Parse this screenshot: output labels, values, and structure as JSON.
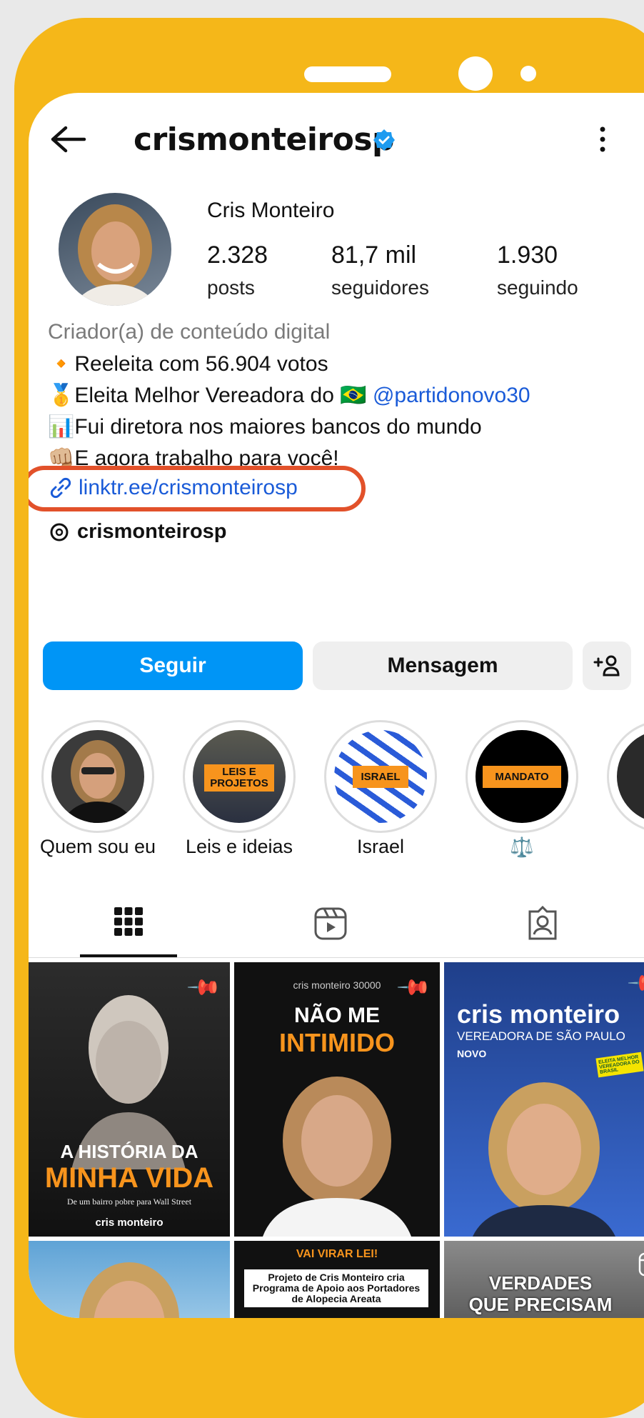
{
  "header": {
    "username": "crismonteirosp"
  },
  "profile": {
    "name": "Cris Monteiro",
    "stats": [
      {
        "value": "2.328",
        "label": "posts"
      },
      {
        "value": "81,7 mil",
        "label": "seguidores"
      },
      {
        "value": "1.930",
        "label": "seguindo"
      }
    ],
    "category": "Criador(a) de conteúdo digital",
    "bio_lines": [
      {
        "emoji": "🔸",
        "text": "Reeleita com 56.904 votos"
      },
      {
        "emoji": "🥇",
        "text": "Eleita Melhor Vereadora do ",
        "flag": "🇧🇷",
        "mention": "@partidonovo30"
      },
      {
        "emoji": "📊",
        "text": "Fui diretora nos maiores bancos do mundo"
      },
      {
        "emoji": "👊🏼",
        "text": "E agora trabalho para você!"
      }
    ],
    "link": "linktr.ee/crismonteirosp",
    "threads": "crismonteirosp"
  },
  "actions": {
    "follow": "Seguir",
    "message": "Mensagem"
  },
  "highlights": [
    {
      "label": "Quem sou eu",
      "tag": ""
    },
    {
      "label": "Leis e ideias",
      "tag": "LEIS E PROJETOS"
    },
    {
      "label": "Israel",
      "tag": "ISRAEL"
    },
    {
      "label": "⚖️",
      "tag": "MANDATO"
    }
  ],
  "tabs": [
    "grid-icon",
    "reels-icon",
    "tagged-icon"
  ],
  "posts": [
    {
      "line1": "A HISTÓRIA DA",
      "line2": "MINHA VIDA",
      "sub": "De um bairro pobre para Wall Street",
      "brand": "cris monteiro"
    },
    {
      "top": "cris monteiro 30000",
      "line1": "NÃO ME",
      "line2": "INTIMIDO"
    },
    {
      "line1": "cris monteiro",
      "line2": "VEREADORA DE SÃO PAULO",
      "sub": "NOVO",
      "badge": "ELEITA MELHOR VEREADORA DO BRASIL"
    },
    {
      "text": ""
    },
    {
      "line1": "VAI VIRAR LEI!",
      "line2": "Projeto de Cris Monteiro cria Programa de Apoio aos Portadores de Alopecia Areata"
    },
    {
      "line1": "VERDADES",
      "line2": "QUE PRECISAM"
    }
  ],
  "colors": {
    "frame": "#F5B719",
    "follow": "#0095F6",
    "link": "#1A5BD8",
    "highlight_ring": "#E2512A",
    "tag": "#F7941D"
  }
}
